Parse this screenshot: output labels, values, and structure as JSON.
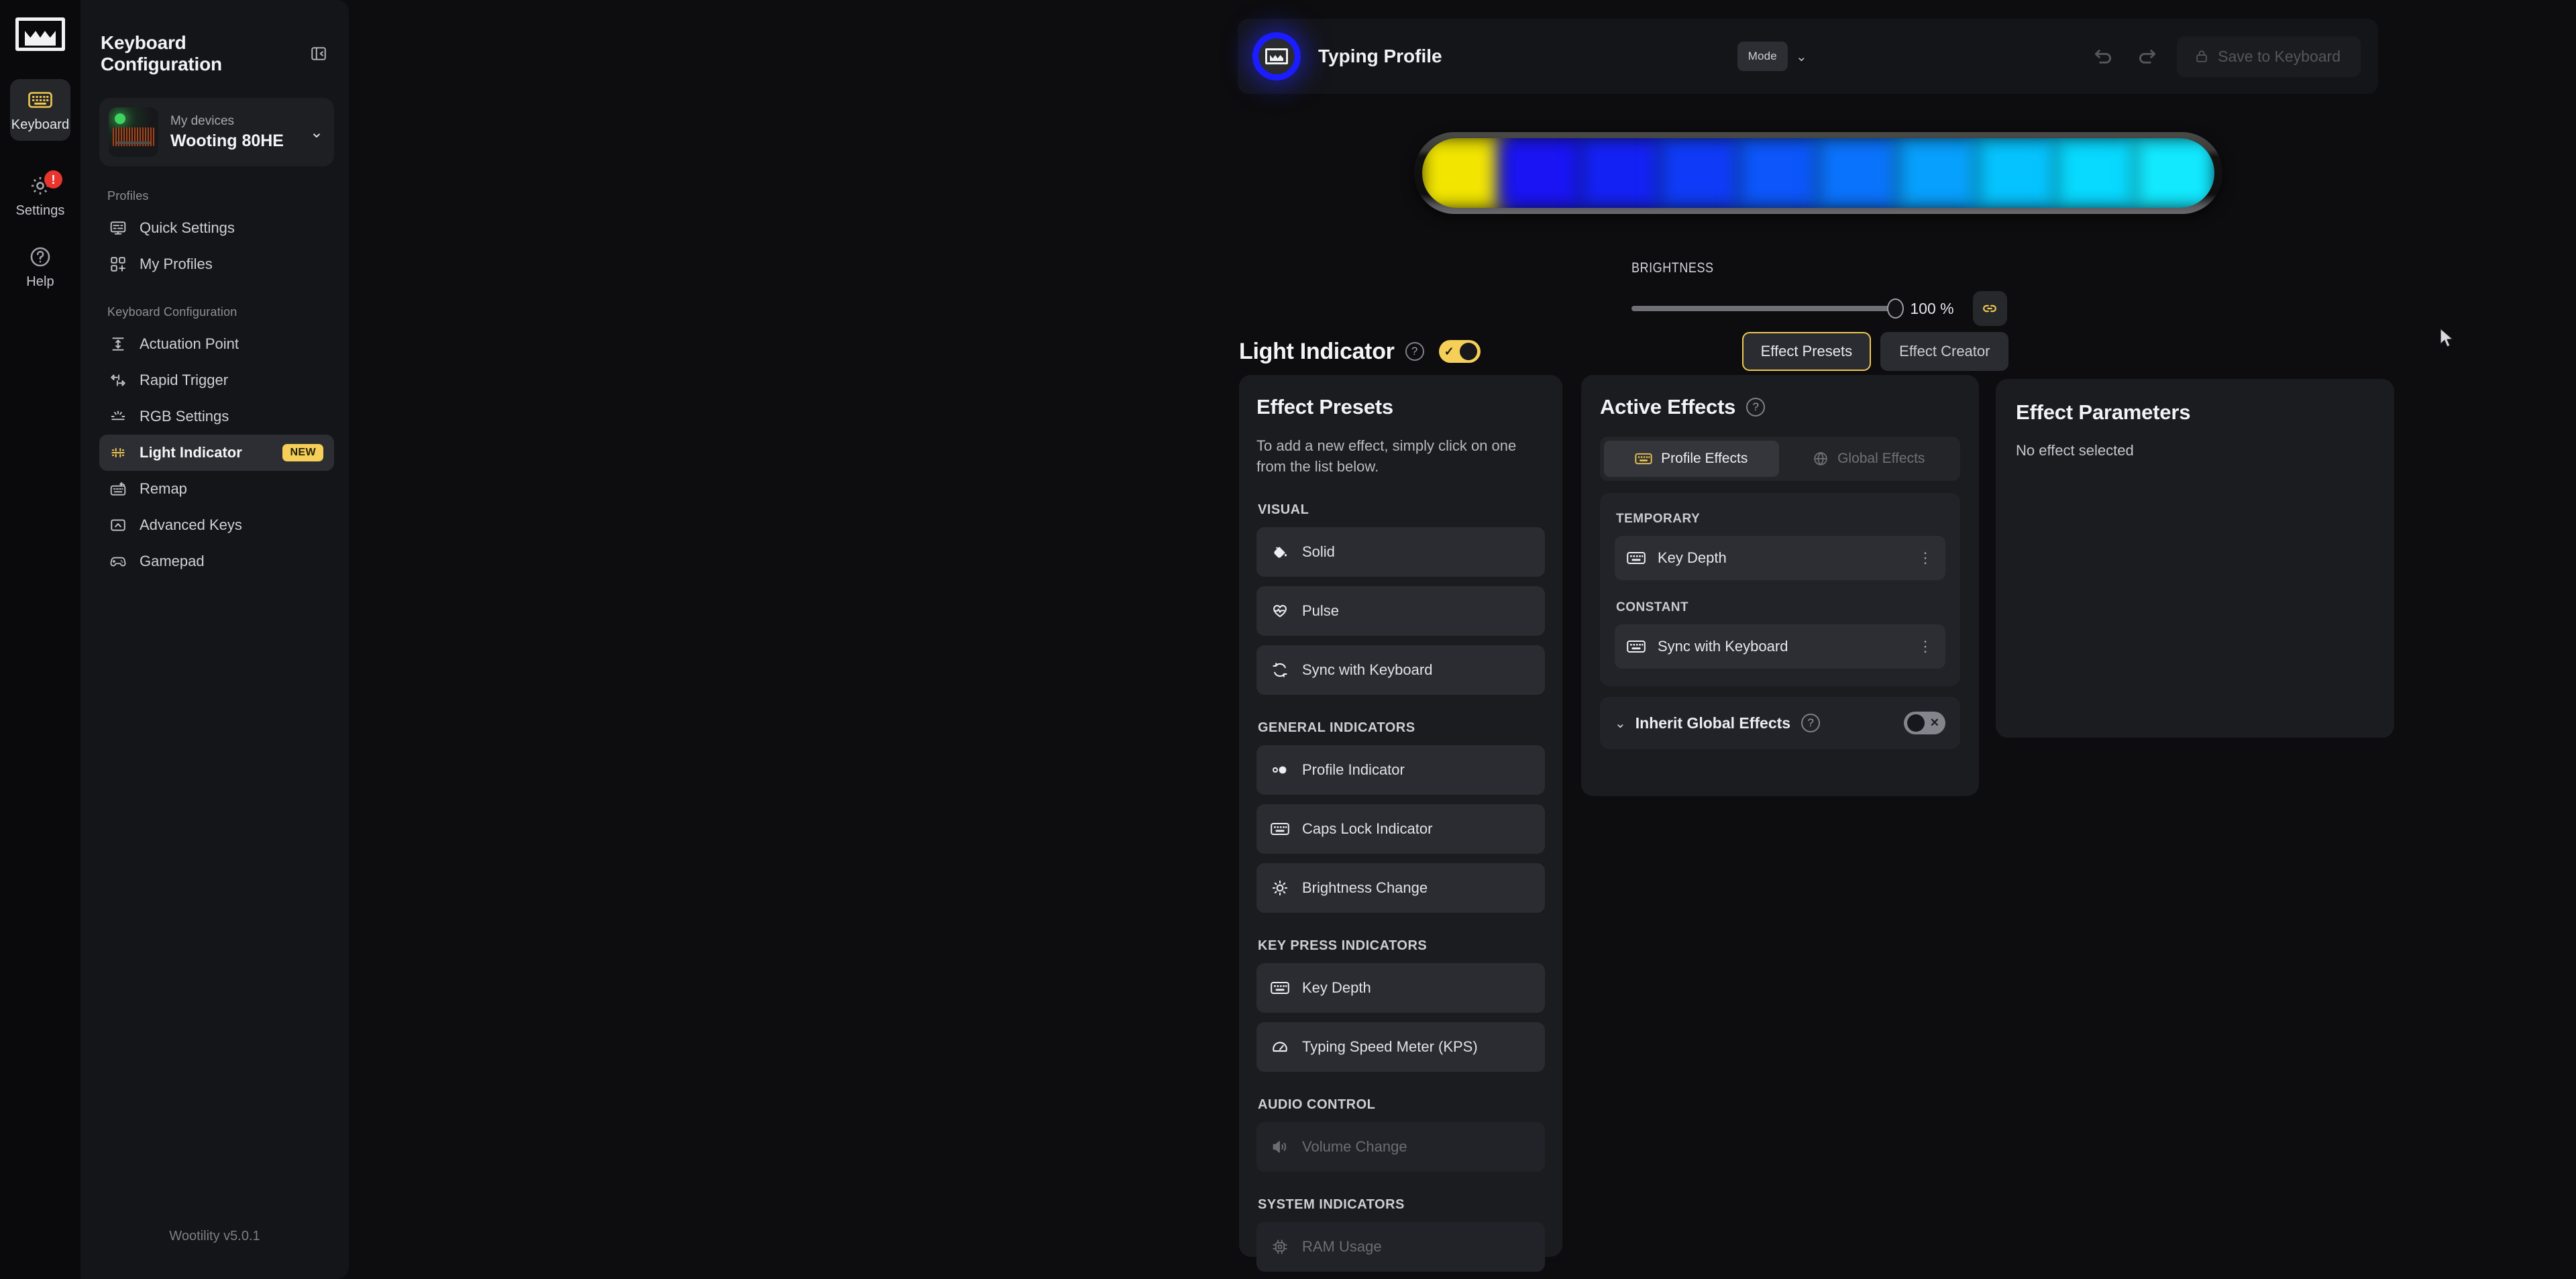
{
  "rail": {
    "logo_icon": "wooting-crown-logo",
    "items": [
      {
        "label": "Keyboard",
        "icon": "keyboard-icon",
        "active": true
      },
      {
        "label": "Settings",
        "icon": "gear-icon",
        "badge": "!"
      },
      {
        "label": "Help",
        "icon": "question-circle-icon"
      }
    ]
  },
  "sidebar": {
    "title": "Keyboard Configuration",
    "collapse_icon": "panel-collapse-icon",
    "device": {
      "subtitle": "My devices",
      "name": "Wooting 80HE",
      "status": "connected",
      "chevron": "⌄"
    },
    "sections": [
      {
        "label": "Profiles",
        "items": [
          {
            "label": "Quick Settings",
            "icon": "monitor-sliders-icon"
          },
          {
            "label": "My Profiles",
            "icon": "grid-plus-icon"
          }
        ]
      },
      {
        "label": "Keyboard Configuration",
        "items": [
          {
            "label": "Actuation Point",
            "icon": "actuation-depth-icon"
          },
          {
            "label": "Rapid Trigger",
            "icon": "rapid-trigger-icon"
          },
          {
            "label": "RGB Settings",
            "icon": "rgb-light-icon"
          },
          {
            "label": "Light Indicator",
            "icon": "light-indicator-icon",
            "badge": "NEW",
            "active": true
          },
          {
            "label": "Remap",
            "icon": "remap-keyboard-icon"
          },
          {
            "label": "Advanced Keys",
            "icon": "advanced-keys-icon"
          },
          {
            "label": "Gamepad",
            "icon": "gamepad-icon"
          }
        ]
      }
    ],
    "footer_version": "Wootility v5.0.1"
  },
  "topbar": {
    "profile_icon": "wooting-profile-avatar",
    "profile_name": "Typing Profile",
    "mode_label": "Mode",
    "mode_chevron": "⌄",
    "undo_icon": "undo-icon",
    "redo_icon": "redo-icon",
    "save_lock_icon": "lock-icon",
    "save_label": "Save to Keyboard",
    "save_disabled": true
  },
  "preview": {
    "leds": [
      "#f2e600",
      "#1a14f5",
      "#1421f5",
      "#0f3bf8",
      "#0c56fb",
      "#0a73fd",
      "#07a0fe",
      "#05c3ff",
      "#07d9ff",
      "#12e9ff"
    ]
  },
  "brightness": {
    "label": "BRIGHTNESS",
    "value": "100 %",
    "percent": 100,
    "link_icon": "link-chain-icon"
  },
  "light_indicator": {
    "title": "Light Indicator",
    "help_icon": "question-circle-icon",
    "enabled": true,
    "toggle_mark": "✓",
    "tabs": [
      {
        "label": "Effect Presets",
        "active": true
      },
      {
        "label": "Effect Creator",
        "active": false
      }
    ]
  },
  "presets": {
    "title": "Effect Presets",
    "description": "To add a new effect, simply click on one from the list below.",
    "groups": [
      {
        "label": "VISUAL",
        "items": [
          {
            "label": "Solid",
            "icon": "paint-bucket-icon",
            "disabled": false
          },
          {
            "label": "Pulse",
            "icon": "heart-pulse-icon",
            "disabled": false
          },
          {
            "label": "Sync with Keyboard",
            "icon": "sync-icon",
            "disabled": false
          }
        ]
      },
      {
        "label": "GENERAL INDICATORS",
        "items": [
          {
            "label": "Profile Indicator",
            "icon": "profile-dots-icon",
            "disabled": false
          },
          {
            "label": "Caps Lock Indicator",
            "icon": "keyboard-icon",
            "disabled": false
          },
          {
            "label": "Brightness Change",
            "icon": "sun-icon",
            "disabled": false
          }
        ]
      },
      {
        "label": "KEY PRESS INDICATORS",
        "items": [
          {
            "label": "Key Depth",
            "icon": "keyboard-icon",
            "disabled": false
          },
          {
            "label": "Typing Speed Meter (KPS)",
            "icon": "gauge-icon",
            "disabled": false
          }
        ]
      },
      {
        "label": "AUDIO CONTROL",
        "items": [
          {
            "label": "Volume Change",
            "icon": "speaker-icon",
            "disabled": true
          }
        ]
      },
      {
        "label": "SYSTEM INDICATORS",
        "items": [
          {
            "label": "RAM Usage",
            "icon": "chip-icon",
            "disabled": true
          }
        ]
      }
    ]
  },
  "active_effects": {
    "title": "Active Effects",
    "help_icon": "question-circle-icon",
    "tabs": [
      {
        "label": "Profile Effects",
        "icon": "keyboard-icon",
        "active": true
      },
      {
        "label": "Global Effects",
        "icon": "globe-icon",
        "active": false
      }
    ],
    "groups": [
      {
        "label": "TEMPORARY",
        "items": [
          {
            "label": "Key Depth",
            "icon": "keyboard-icon",
            "menu_icon": "kebab-menu-icon"
          }
        ]
      },
      {
        "label": "CONSTANT",
        "items": [
          {
            "label": "Sync with Keyboard",
            "icon": "keyboard-icon",
            "menu_icon": "kebab-menu-icon"
          }
        ]
      }
    ],
    "inherit": {
      "label": "Inherit Global Effects",
      "help_icon": "question-circle-icon",
      "chevron": "⌄",
      "enabled": false,
      "toggle_mark": "✕"
    }
  },
  "effect_parameters": {
    "title": "Effect Parameters",
    "empty_text": "No effect selected"
  },
  "colors": {
    "accent_yellow": "#f5cf57",
    "danger_red": "#e8352e",
    "status_green": "#3fd35f",
    "panel_bg": "#1b1c20",
    "app_bg": "#0d0d0f",
    "sidebar_bg": "#141518"
  }
}
